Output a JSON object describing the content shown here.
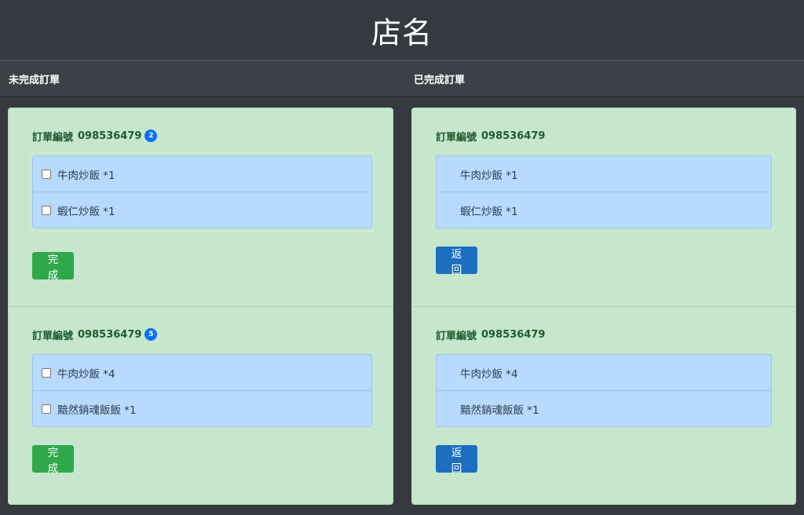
{
  "header": {
    "title": "店名"
  },
  "columns": {
    "pending_title": "未完成訂單",
    "done_title": "已完成訂單"
  },
  "pending": [
    {
      "label": "訂單編號",
      "number": "098536479",
      "badge": "2",
      "items": [
        "牛肉炒飯 *1",
        "蝦仁炒飯 *1"
      ],
      "button": "完成"
    },
    {
      "label": "訂單編號",
      "number": "098536479",
      "badge": "5",
      "items": [
        "牛肉炒飯 *4",
        "黯然銷魂飯飯 *1"
      ],
      "button": "完成"
    }
  ],
  "done": [
    {
      "label": "訂單編號",
      "number": "098536479",
      "items": [
        "牛肉炒飯 *1",
        "蝦仁炒飯 *1"
      ],
      "button": "返回"
    },
    {
      "label": "訂單編號",
      "number": "098536479",
      "items": [
        "牛肉炒飯 *4",
        "黯然銷魂飯飯 *1"
      ],
      "button": "返回"
    }
  ],
  "colors": {
    "header_bg": "#343a40",
    "panel_bg": "#c6e7cd",
    "item_bg": "#b8daff",
    "badge_bg": "#0d6efd",
    "complete_btn": "#2fa84a",
    "return_btn": "#1c6fbf"
  }
}
